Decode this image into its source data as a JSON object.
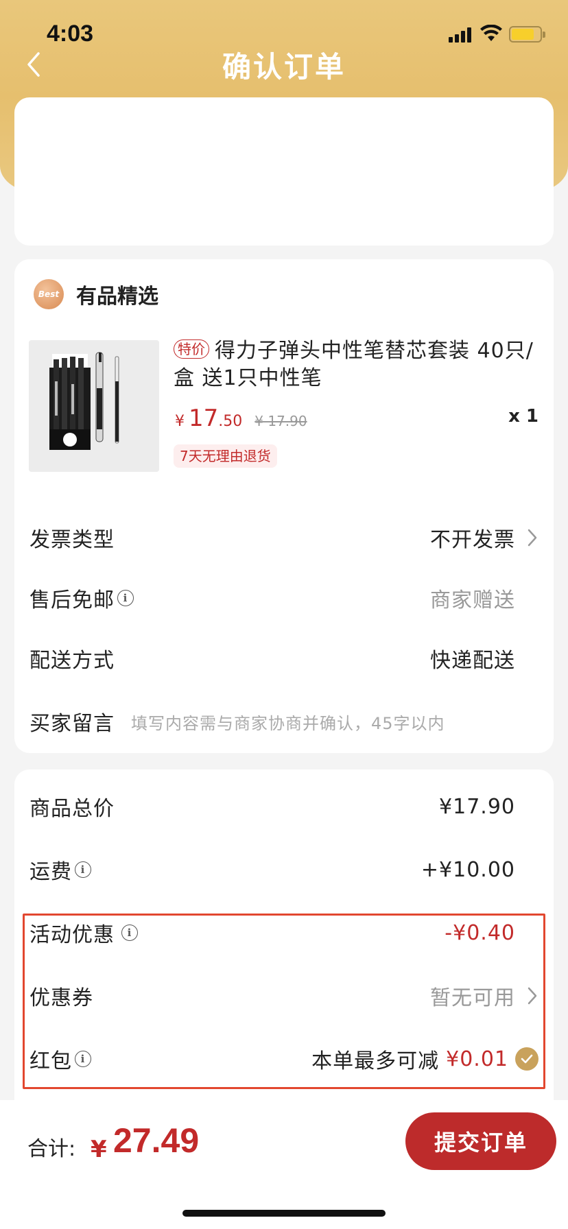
{
  "status_bar": {
    "time": "4:03"
  },
  "nav": {
    "title": "确认订单"
  },
  "shop": {
    "badge": "Best",
    "name": "有品精选",
    "product": {
      "tag": "特价",
      "title": "得力子弹头中性笔替芯套装 40只/盒 送1只中性笔",
      "currency": "¥",
      "price_int": "17",
      "price_dec": ".50",
      "original_price": "¥ 17.90",
      "quantity": "x 1",
      "return_policy": "7天无理由退货"
    },
    "options": {
      "invoice_label": "发票类型",
      "invoice_value": "不开发票",
      "aftersale_label": "售后免邮",
      "aftersale_value": "商家赠送",
      "delivery_label": "配送方式",
      "delivery_value": "快递配送",
      "message_label": "买家留言",
      "message_placeholder": "填写内容需与商家协商并确认，45字以内"
    }
  },
  "pricing": {
    "subtotal_label": "商品总价",
    "subtotal_value": "¥17.90",
    "shipping_label": "运费",
    "shipping_value": "+¥10.00",
    "promo_label": "活动优惠",
    "promo_value": "-¥0.40",
    "coupon_label": "优惠券",
    "coupon_value": "暂无可用",
    "redpacket_label": "红包",
    "redpacket_text": "本单最多可减",
    "redpacket_amount": "¥0.01"
  },
  "footer": {
    "total_label": "合计:",
    "total_currency": "¥",
    "total_value": "27.49",
    "submit_label": "提交订单"
  },
  "colors": {
    "accent_red": "#c22a2a",
    "header_gold": "#e6bf6e",
    "highlight_border": "#e2472f"
  }
}
